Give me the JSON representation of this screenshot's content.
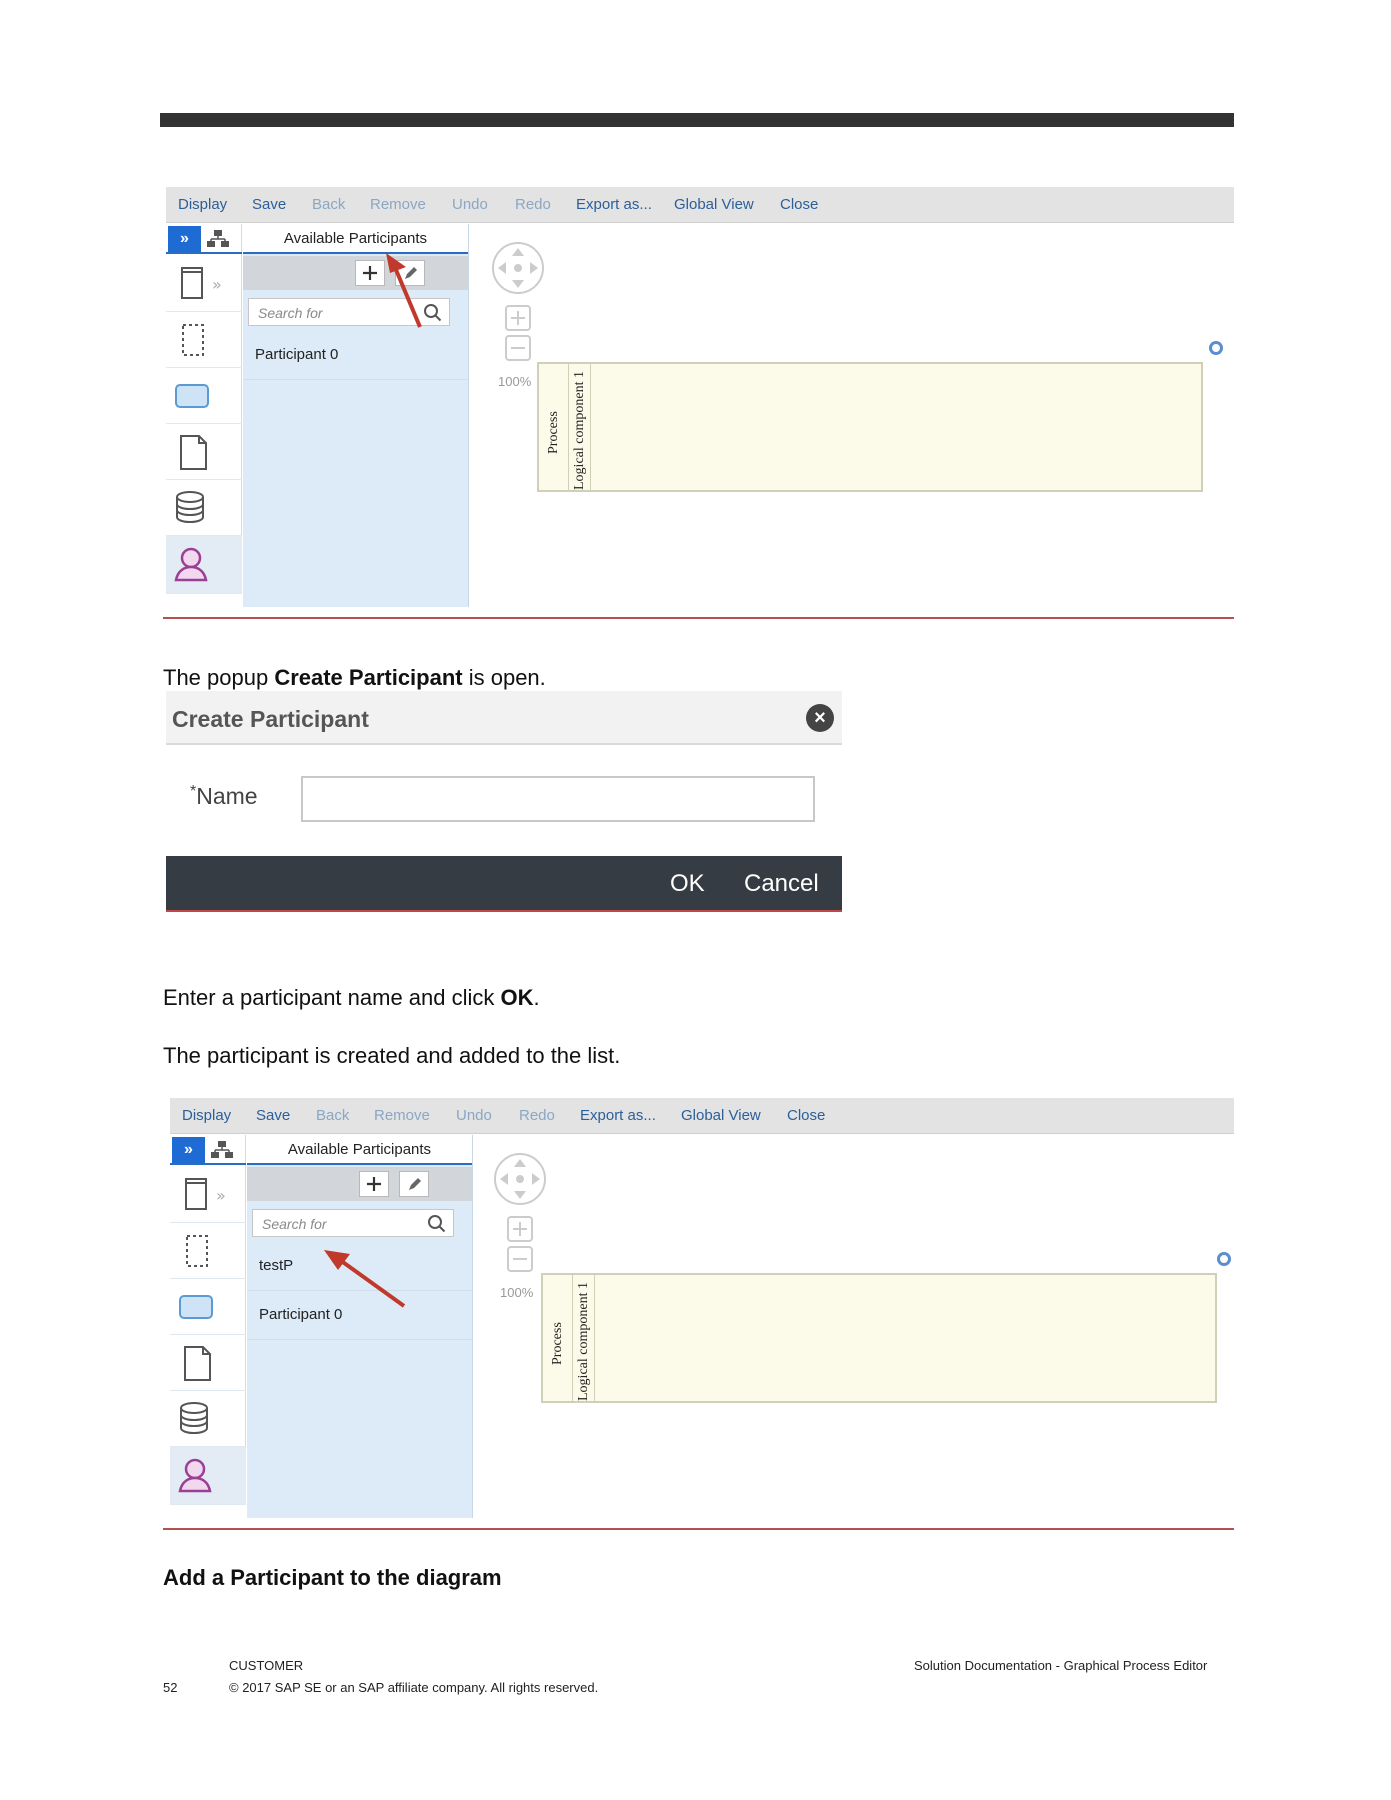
{
  "toolbar": {
    "display": "Display",
    "save": "Save",
    "back": "Back",
    "remove": "Remove",
    "undo": "Undo",
    "redo": "Redo",
    "export": "Export as...",
    "global_view": "Global View",
    "close": "Close"
  },
  "panel": {
    "title": "Available Participants",
    "search_placeholder": "Search for",
    "participant_0": "Participant 0",
    "new_participant": "testP"
  },
  "canvas": {
    "zoom": "100%",
    "lane_process": "Process",
    "lane_component": "Logical component 1"
  },
  "text": {
    "popup_pre": "The popup ",
    "popup_bold": "Create Participant",
    "popup_post": " is open.",
    "enter_pre": "Enter a participant name and click ",
    "enter_bold": "OK",
    "enter_post": ".",
    "created": "The participant is created and added to the list.",
    "heading": "Add a Participant to the diagram"
  },
  "dialog": {
    "title": "Create Participant",
    "required_marker": "*",
    "name_label": "Name",
    "ok": "OK",
    "cancel": "Cancel"
  },
  "footer": {
    "page_number": "52",
    "classification": "CUSTOMER",
    "copyright": "© 2017 SAP SE or an SAP affiliate company. All rights reserved.",
    "doc_title": "Solution Documentation - Graphical Process Editor"
  },
  "colors": {
    "accent_blue": "#1f6bd4",
    "arrow_red": "#c0392b",
    "rule_red": "#b45050"
  }
}
